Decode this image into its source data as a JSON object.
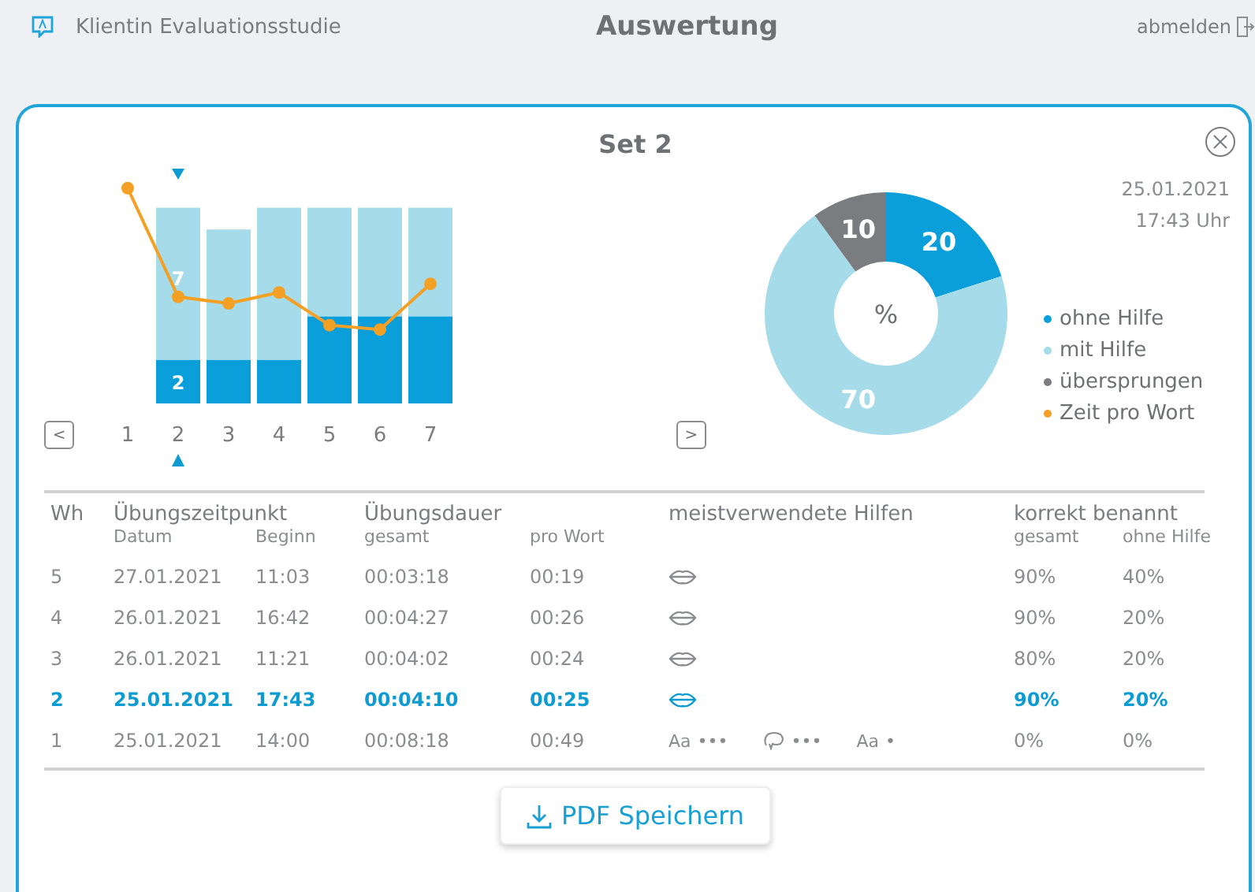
{
  "header": {
    "app_name": "Klientin Evaluationsstudie",
    "title": "Auswertung",
    "logout": "abmelden"
  },
  "card": {
    "title": "Set 2",
    "date": "25.01.2021",
    "time": "17:43 Uhr"
  },
  "bar_chart": {
    "prev": "<",
    "next": ">",
    "sessions": [
      {
        "label": "1",
        "selected": false
      },
      {
        "label": "2",
        "selected": true
      },
      {
        "label": "3",
        "selected": false
      },
      {
        "label": "4",
        "selected": false
      },
      {
        "label": "5",
        "selected": false
      },
      {
        "label": "6",
        "selected": false
      },
      {
        "label": "7",
        "selected": false
      }
    ],
    "bar_labels": [
      "7",
      "2"
    ]
  },
  "time_legend": {
    "label": "Zeit pro Wort",
    "color": "#f4a025"
  },
  "donut": {
    "center_label": "%",
    "chart_data": {
      "type": "donut",
      "categories": [
        "ohne Hilfe",
        "mit Hilfe",
        "übersprungen"
      ],
      "values": [
        20,
        70,
        10
      ],
      "colors": [
        "#0a9edb",
        "#a6dbea",
        "#7b7c80"
      ],
      "data_labels": true
    }
  },
  "table": {
    "group_headers": [
      "Wh",
      "Übungszeitpunkt",
      "Übungsdauer",
      "meistverwendete Hilfen",
      "korrekt benannt"
    ],
    "sub_headers": [
      "Datum",
      "Beginn",
      "gesamt",
      "pro Wort",
      "gesamt",
      "ohne Hilfe"
    ],
    "rows": [
      {
        "wh": "5",
        "datum": "27.01.2021",
        "beginn": "11:03",
        "gesamt": "00:03:18",
        "pro_wort": "00:19",
        "hilfen": [
          {
            "kind": "lips"
          }
        ],
        "korrekt_gesamt": "90%",
        "ohne_hilfe": "40%",
        "selected": false
      },
      {
        "wh": "4",
        "datum": "26.01.2021",
        "beginn": "16:42",
        "gesamt": "00:04:27",
        "pro_wort": "00:26",
        "hilfen": [
          {
            "kind": "lips"
          }
        ],
        "korrekt_gesamt": "90%",
        "ohne_hilfe": "20%",
        "selected": false
      },
      {
        "wh": "3",
        "datum": "26.01.2021",
        "beginn": "11:21",
        "gesamt": "00:04:02",
        "pro_wort": "00:24",
        "hilfen": [
          {
            "kind": "lips"
          }
        ],
        "korrekt_gesamt": "80%",
        "ohne_hilfe": "20%",
        "selected": false
      },
      {
        "wh": "2",
        "datum": "25.01.2021",
        "beginn": "17:43",
        "gesamt": "00:04:10",
        "pro_wort": "00:25",
        "hilfen": [
          {
            "kind": "lips"
          }
        ],
        "korrekt_gesamt": "90%",
        "ohne_hilfe": "20%",
        "selected": true
      },
      {
        "wh": "1",
        "datum": "25.01.2021",
        "beginn": "14:00",
        "gesamt": "00:08:18",
        "pro_wort": "00:49",
        "hilfen": [
          {
            "kind": "letters",
            "label": "Aa",
            "dots": "•••"
          },
          {
            "kind": "speech",
            "dots": "•••"
          },
          {
            "kind": "letters",
            "label": "Aa",
            "dots": "•"
          }
        ],
        "korrekt_gesamt": "0%",
        "ohne_hilfe": "0%",
        "selected": false
      }
    ]
  },
  "pdf_button": "PDF Speichern"
}
